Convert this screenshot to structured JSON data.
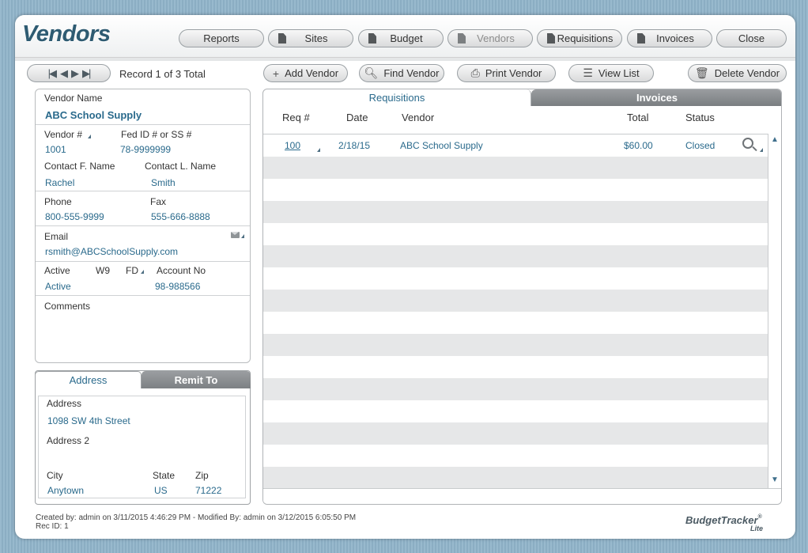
{
  "header": {
    "title": "Vendors",
    "nav": [
      {
        "label": "Reports",
        "icon": "none",
        "enabled": true
      },
      {
        "label": "Sites",
        "icon": "document-icon",
        "enabled": true
      },
      {
        "label": "Budget",
        "icon": "document-icon",
        "enabled": true
      },
      {
        "label": "Vendors",
        "icon": "document-icon",
        "enabled": false
      },
      {
        "label": "Requisitions",
        "icon": "document-icon",
        "enabled": true
      },
      {
        "label": "Invoices",
        "icon": "document-icon",
        "enabled": true
      },
      {
        "label": "Close",
        "icon": "none",
        "enabled": true
      }
    ]
  },
  "toolbar": {
    "record_text": "Record 1 of 3 Total",
    "add_vendor": "Add Vendor",
    "find_vendor": "Find Vendor",
    "print_vendor": "Print Vendor",
    "view_list": "View List",
    "delete_vendor": "Delete Vendor"
  },
  "vendor": {
    "name_label": "Vendor Name",
    "name": "ABC School Supply",
    "vendor_no_label": "Vendor #",
    "vendor_no": "1001",
    "fed_id_label": "Fed ID # or SS #",
    "fed_id": "78-9999999",
    "contact_first_label": "Contact F. Name",
    "contact_first": "Rachel",
    "contact_last_label": "Contact L. Name",
    "contact_last": "Smith",
    "phone_label": "Phone",
    "phone": "800-555-9999",
    "fax_label": "Fax",
    "fax": "555-666-8888",
    "email_label": "Email",
    "email": "rsmith@ABCSchoolSupply.com",
    "active_label": "Active",
    "active": "Active",
    "w9_label": "W9",
    "fd_label": "FD",
    "account_label": "Account No",
    "account": "98-988566",
    "comments_label": "Comments"
  },
  "address_tabs": {
    "address": "Address",
    "remit_to": "Remit To"
  },
  "address": {
    "address_label": "Address",
    "address": "1098 SW 4th Street",
    "address2_label": "Address 2",
    "city_label": "City",
    "city": "Anytown",
    "state_label": "State",
    "state": "US",
    "zip_label": "Zip",
    "zip": "71222"
  },
  "right_tabs": {
    "requisitions": "Requisitions",
    "invoices": "Invoices"
  },
  "requisitions": {
    "columns": [
      "Req #",
      "Date",
      "Vendor",
      "Total",
      "Status"
    ],
    "rows": [
      {
        "req": "100",
        "date": "2/18/15",
        "vendor": "ABC School Supply",
        "total": "$60.00",
        "status": "Closed"
      }
    ]
  },
  "footer": {
    "created_line": "Created by: admin on 3/11/2015 4:46:29 PM - Modified By: admin on 3/12/2015 6:05:50 PM",
    "rec_id": "Rec ID: 1",
    "brand": "BudgetTracker",
    "brand_reg": "®",
    "brand_sub": "Lite"
  },
  "colors": {
    "accent_text": "#2a6a8c",
    "title": "#2e5b72",
    "background": "#8fb3c9"
  }
}
